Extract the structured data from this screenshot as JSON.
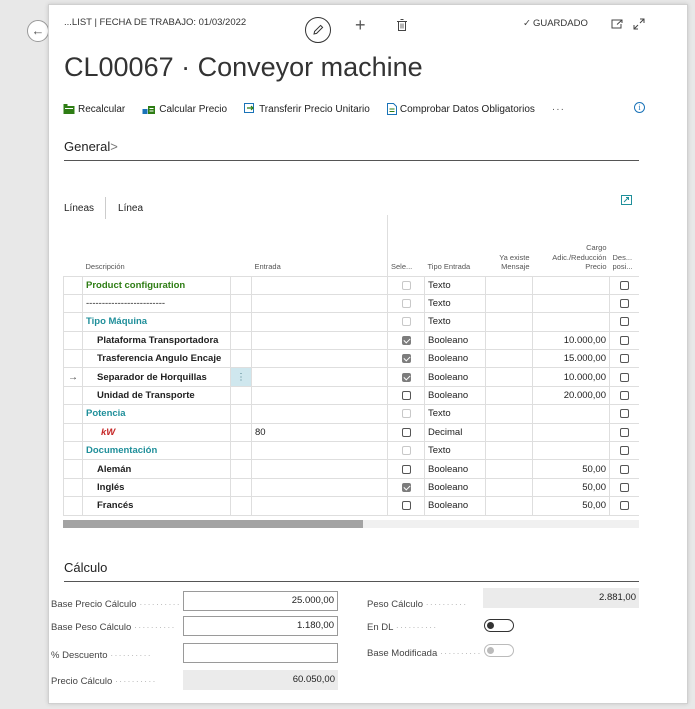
{
  "header": {
    "breadcrumb": "...LIST | FECHA DE TRABAJO: 01/03/2022",
    "saved_label": "GUARDADO",
    "title": "CL00067 · Conveyor machine"
  },
  "actions": [
    {
      "label": "Recalcular",
      "icon": "recalculate-icon"
    },
    {
      "label": "Calcular Precio",
      "icon": "calculate-price-icon"
    },
    {
      "label": "Transferir Precio Unitario",
      "icon": "transfer-price-icon"
    },
    {
      "label": "Comprobar Datos Obligatorios",
      "icon": "check-data-icon"
    }
  ],
  "more_label": "···",
  "general": {
    "title": "General",
    "chevron": ">"
  },
  "lines": {
    "tabs": [
      "Líneas",
      "Línea"
    ],
    "columns": {
      "descripcion": "Descripción",
      "entrada": "Entrada",
      "sele": "Sele...",
      "tipo_entrada": "Tipo Entrada",
      "ya_existe": "Ya existe Mensaje",
      "cargo": "Cargo Adic./Reducción Precio",
      "des": "Des... posi..."
    },
    "rows": [
      {
        "desc": "Product configuration",
        "style": "green",
        "entrada": "",
        "sel": "disabled",
        "tipo": "Texto",
        "cargo": "",
        "des": false
      },
      {
        "desc": "-------------------------",
        "style": "plain",
        "entrada": "",
        "sel": "disabled",
        "tipo": "Texto",
        "cargo": "",
        "des": false
      },
      {
        "desc": "Tipo Máquina",
        "style": "teal",
        "entrada": "",
        "sel": "disabled",
        "tipo": "Texto",
        "cargo": "",
        "des": false
      },
      {
        "desc": "Plataforma Transportadora",
        "style": "ind",
        "entrada": "",
        "sel": "checked-gray",
        "tipo": "Booleano",
        "cargo": "10.000,00",
        "des": false
      },
      {
        "desc": "Trasferencia Angulo Encaje",
        "style": "ind",
        "entrada": "",
        "sel": "checked-gray",
        "tipo": "Booleano",
        "cargo": "15.000,00",
        "des": false
      },
      {
        "desc": "Separador de Horquillas",
        "style": "ind",
        "entrada": "",
        "sel": "checked-gray",
        "tipo": "Booleano",
        "cargo": "10.000,00",
        "des": false,
        "current": true
      },
      {
        "desc": "Unidad de Transporte",
        "style": "ind",
        "entrada": "",
        "sel": "unchecked",
        "tipo": "Booleano",
        "cargo": "20.000,00",
        "des": false
      },
      {
        "desc": "Potencia",
        "style": "teal",
        "entrada": "",
        "sel": "disabled",
        "tipo": "Texto",
        "cargo": "",
        "des": false
      },
      {
        "desc": "kW",
        "style": "red",
        "entrada": "80",
        "sel": "unchecked",
        "tipo": "Decimal",
        "cargo": "",
        "des": false
      },
      {
        "desc": "Documentación",
        "style": "teal",
        "entrada": "",
        "sel": "disabled",
        "tipo": "Texto",
        "cargo": "",
        "des": false
      },
      {
        "desc": "Alemán",
        "style": "ind",
        "entrada": "",
        "sel": "unchecked",
        "tipo": "Booleano",
        "cargo": "50,00",
        "des": false
      },
      {
        "desc": "Inglés",
        "style": "ind",
        "entrada": "",
        "sel": "checked-gray",
        "tipo": "Booleano",
        "cargo": "50,00",
        "des": false
      },
      {
        "desc": "Francés",
        "style": "ind",
        "entrada": "",
        "sel": "unchecked",
        "tipo": "Booleano",
        "cargo": "50,00",
        "des": false
      }
    ],
    "current_row_dots": "⋮",
    "current_row_arrow": "→"
  },
  "calculo": {
    "title": "Cálculo",
    "base_precio_label": "Base Precio Cálculo",
    "base_precio_value": "25.000,00",
    "base_peso_label": "Base Peso Cálculo",
    "base_peso_value": "1.180,00",
    "descuento_label": "% Descuento",
    "descuento_value": "",
    "precio_label": "Precio Cálculo",
    "precio_value": "60.050,00",
    "peso_label": "Peso Cálculo",
    "peso_value": "2.881,00",
    "en_dl_label": "En DL",
    "en_dl_value": false,
    "base_mod_label": "Base Modificada",
    "base_mod_value": false,
    "dots": "··········"
  },
  "colors": {
    "accent_green": "#2e7d14",
    "accent_teal": "#1f8f9a",
    "accent_red": "#c62828",
    "link_blue": "#1a73b8"
  }
}
